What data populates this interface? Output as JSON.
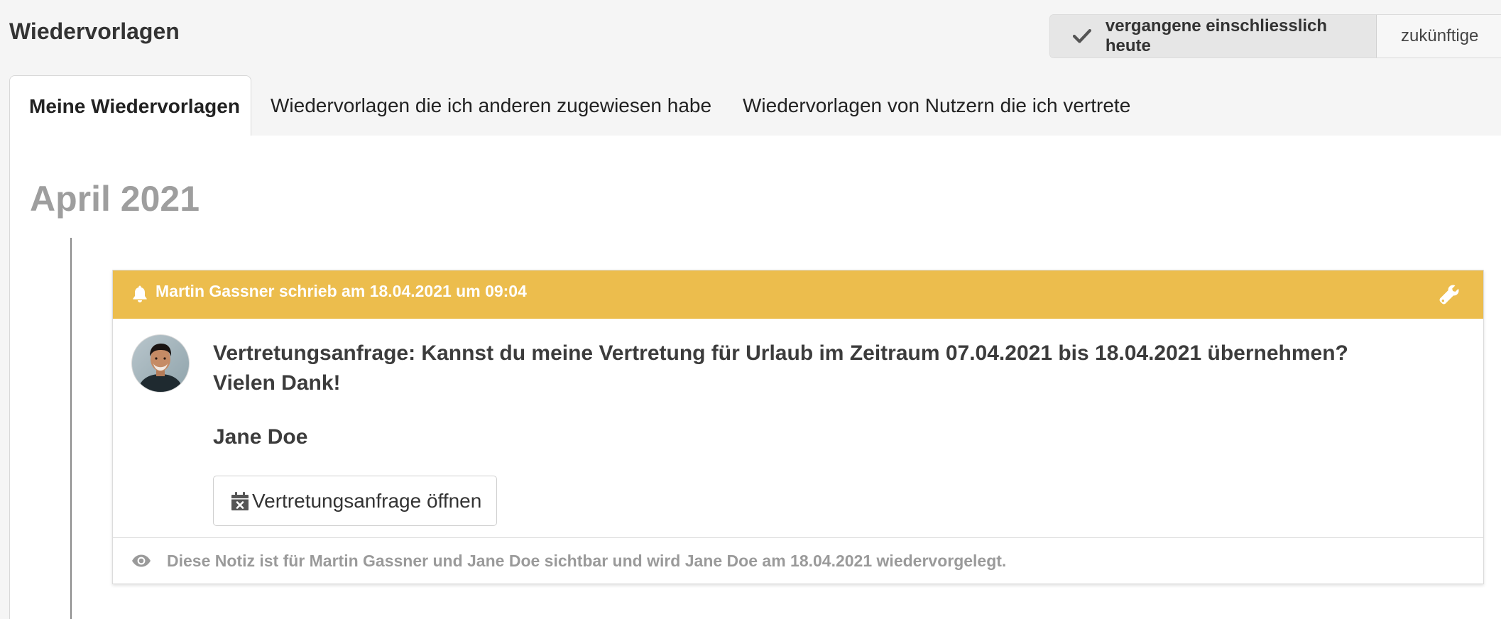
{
  "header": {
    "title": "Wiedervorlagen",
    "filter_past": "vergangene einschliesslich heute",
    "filter_future": "zukünftige"
  },
  "tabs": [
    {
      "label": "Meine Wiedervorlagen",
      "active": true
    },
    {
      "label": "Wiedervorlagen die ich anderen zugewiesen habe",
      "active": false
    },
    {
      "label": "Wiedervorlagen von Nutzern die ich vertrete",
      "active": false
    }
  ],
  "timeline": {
    "month": "April 2021"
  },
  "card": {
    "header_color": "#ecbd4d",
    "author_line": "Martin Gassner schrieb am 18.04.2021 um 09:04",
    "message_line1": "Vertretungsanfrage: Kannst du meine Vertretung für Urlaub im Zeitraum 07.04.2021 bis 18.04.2021 übernehmen?",
    "message_line2": "Vielen Dank!",
    "signature": "Jane Doe",
    "action_label": "Vertretungsanfrage öffnen",
    "visibility_note": "Diese Notiz ist für Martin Gassner und Jane Doe sichtbar und wird Jane Doe am 18.04.2021 wiedervorgelegt.",
    "icons": {
      "header_left": "bell-icon",
      "header_right": "wrench-icon",
      "action": "calendar-x-icon",
      "footer": "eye-icon"
    }
  }
}
